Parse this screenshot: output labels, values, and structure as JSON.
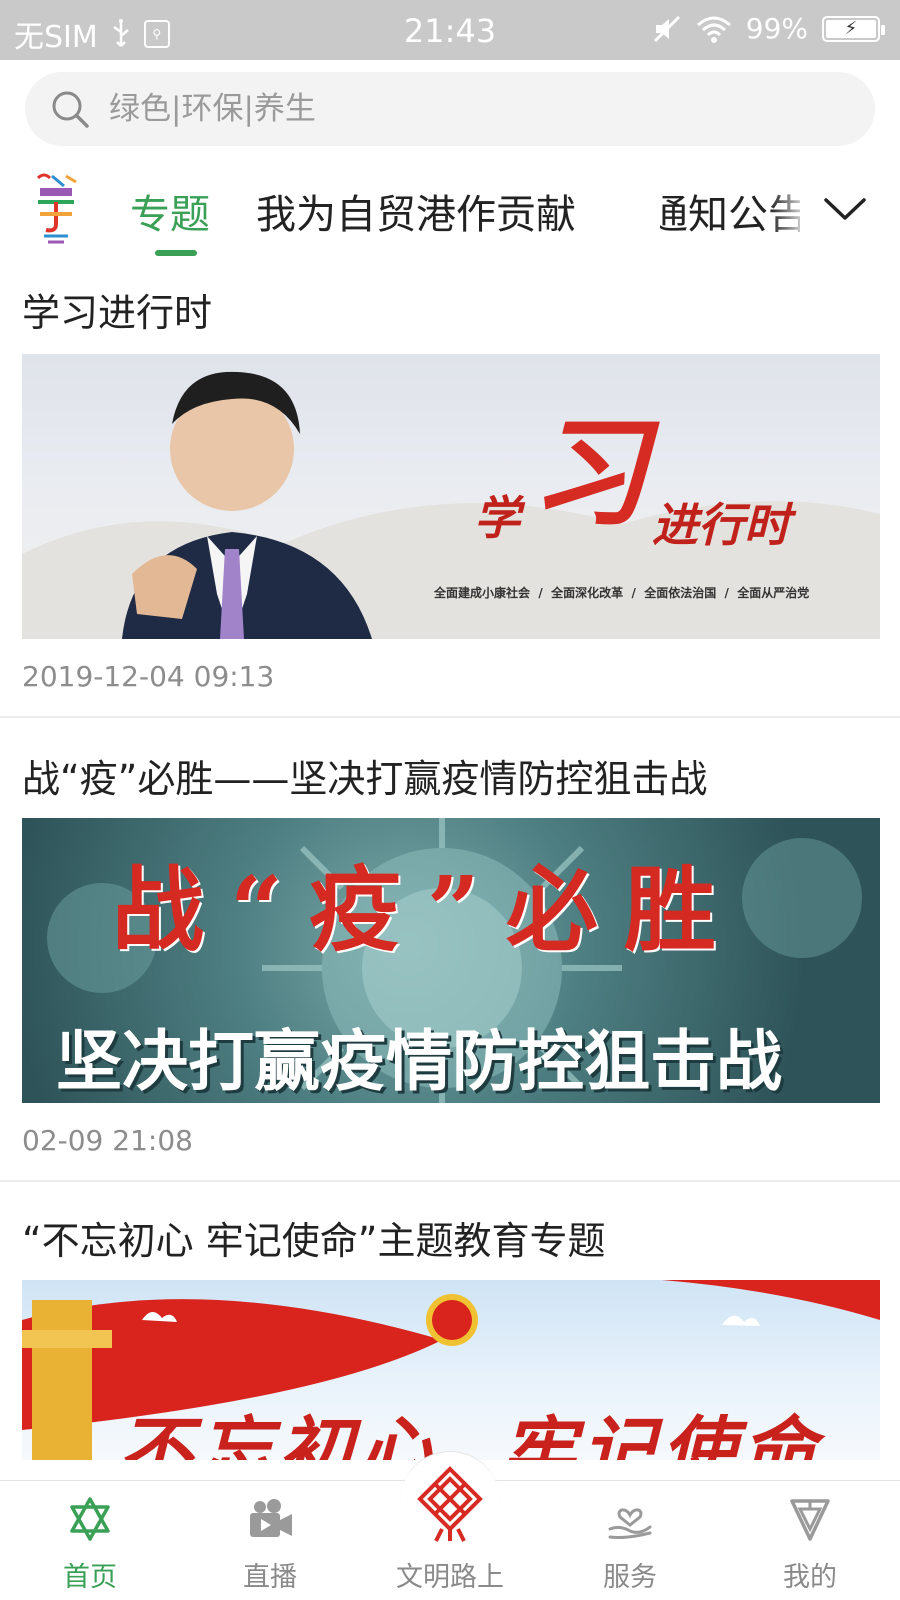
{
  "status_bar": {
    "carrier": "无SIM",
    "time": "21:43",
    "battery": "99%"
  },
  "search": {
    "placeholder": "绿色|环保|养生"
  },
  "tabs": {
    "items": [
      {
        "label": "专题",
        "active": true
      },
      {
        "label": "我为自贸港作贡献",
        "active": false
      },
      {
        "label": "通知公告",
        "active": false
      }
    ],
    "accent_color": "#3aa056"
  },
  "articles": [
    {
      "title": "学习进行时",
      "time": "2019-12-04 09:13",
      "banner": {
        "headline_a": "学",
        "headline_b": "习",
        "headline_c": "进行时",
        "tagline": "全面建成小康社会  /  全面深化改革  /  全面依法治国  /  全面从严治党"
      }
    },
    {
      "title": "战“疫”必胜——坚决打赢疫情防控狙击战",
      "time": "02-09 21:08",
      "banner": {
        "headline": "战“疫”必胜",
        "subline": "坚决打赢疫情防控狙击战"
      }
    },
    {
      "title": "“不忘初心 牢记使命”主题教育专题",
      "time": "",
      "banner": {
        "headline": "不忘初心  牢记使命"
      }
    }
  ],
  "bottom_nav": {
    "items": [
      {
        "label": "首页",
        "icon": "star-of-david-icon",
        "active": true
      },
      {
        "label": "直播",
        "icon": "video-camera-icon",
        "active": false
      },
      {
        "label": "文明路上",
        "icon": "knot-emblem-icon",
        "active": false
      },
      {
        "label": "服务",
        "icon": "hand-heart-icon",
        "active": false
      },
      {
        "label": "我的",
        "icon": "profile-emblem-icon",
        "active": false
      }
    ]
  }
}
